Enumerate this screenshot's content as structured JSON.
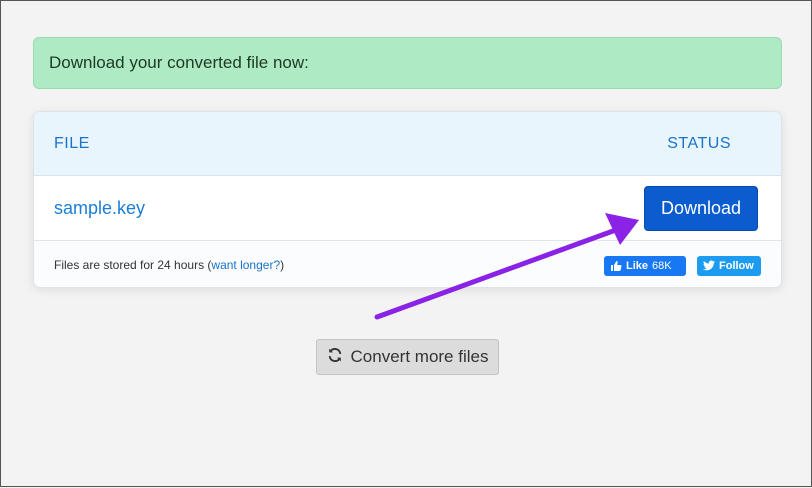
{
  "alert": {
    "text": "Download your converted file now:"
  },
  "table": {
    "headers": {
      "file": "FILE",
      "status": "STATUS"
    },
    "rows": [
      {
        "file_name": "sample.key",
        "action_label": "Download"
      }
    ],
    "footer": {
      "note_prefix": "Files are stored for 24 hours (",
      "note_link": "want longer?",
      "note_suffix": ")"
    }
  },
  "social": {
    "like_label": "Like",
    "like_count": "68K",
    "follow_label": "Follow"
  },
  "convert_button": {
    "label": "Convert more files",
    "icon": "refresh-icon"
  },
  "annotation": {
    "arrow_color": "#8a23e6"
  },
  "colors": {
    "accent": "#0a5ccf",
    "alert_bg": "#aeeac3",
    "link": "#1a73c8"
  }
}
